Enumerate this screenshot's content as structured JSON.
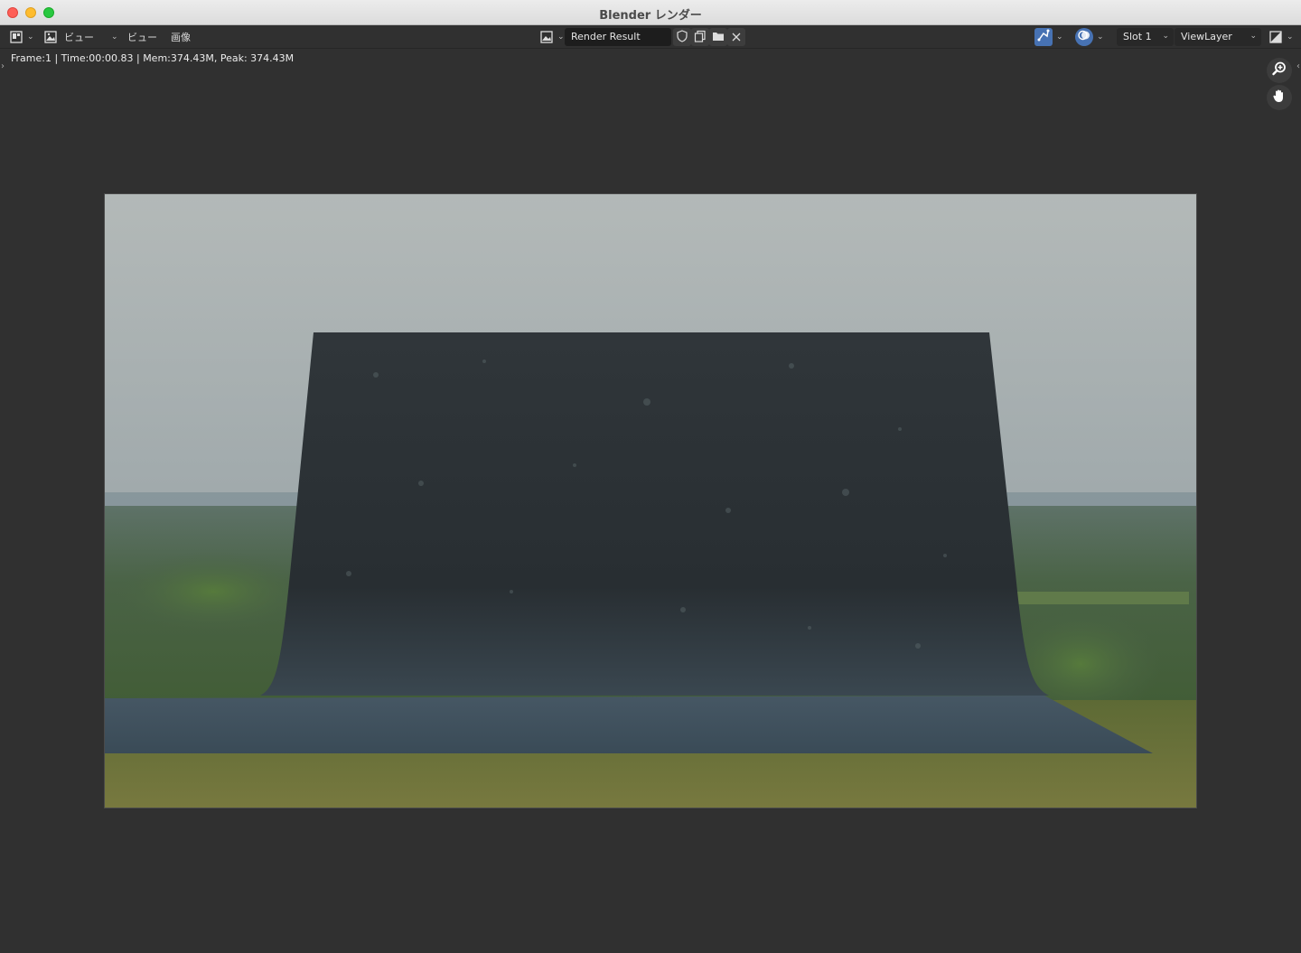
{
  "window": {
    "title": "Blender レンダー"
  },
  "header": {
    "editor_type_icon": "image-editor-icon",
    "mode_icon": "image-mode-icon",
    "mode_label": "ビュー",
    "menus": [
      "ビュー",
      "画像"
    ],
    "image_browse_icon": "image-browse-icon",
    "image_name": "Render Result",
    "fake_user_icon": "shield-icon",
    "duplicate_icon": "duplicate-icon",
    "open_icon": "folder-icon",
    "unlink_icon": "close-icon",
    "gizmo_icon": "gizmo-icon",
    "overlay_icon": "overlay-icon",
    "slot_label": "Slot 1",
    "view_layer_label": "ViewLayer",
    "display_channels_icon": "display-channels-icon"
  },
  "status": {
    "text": "Frame:1 | Time:00:00.83 | Mem:374.43M, Peak: 374.43M"
  },
  "nav": {
    "zoom_icon": "zoom-icon",
    "pan_icon": "hand-icon"
  },
  "colors": {
    "editor_bg": "#303030",
    "field_bg": "#1d1d1d",
    "accent_blue": "#4772b3"
  }
}
